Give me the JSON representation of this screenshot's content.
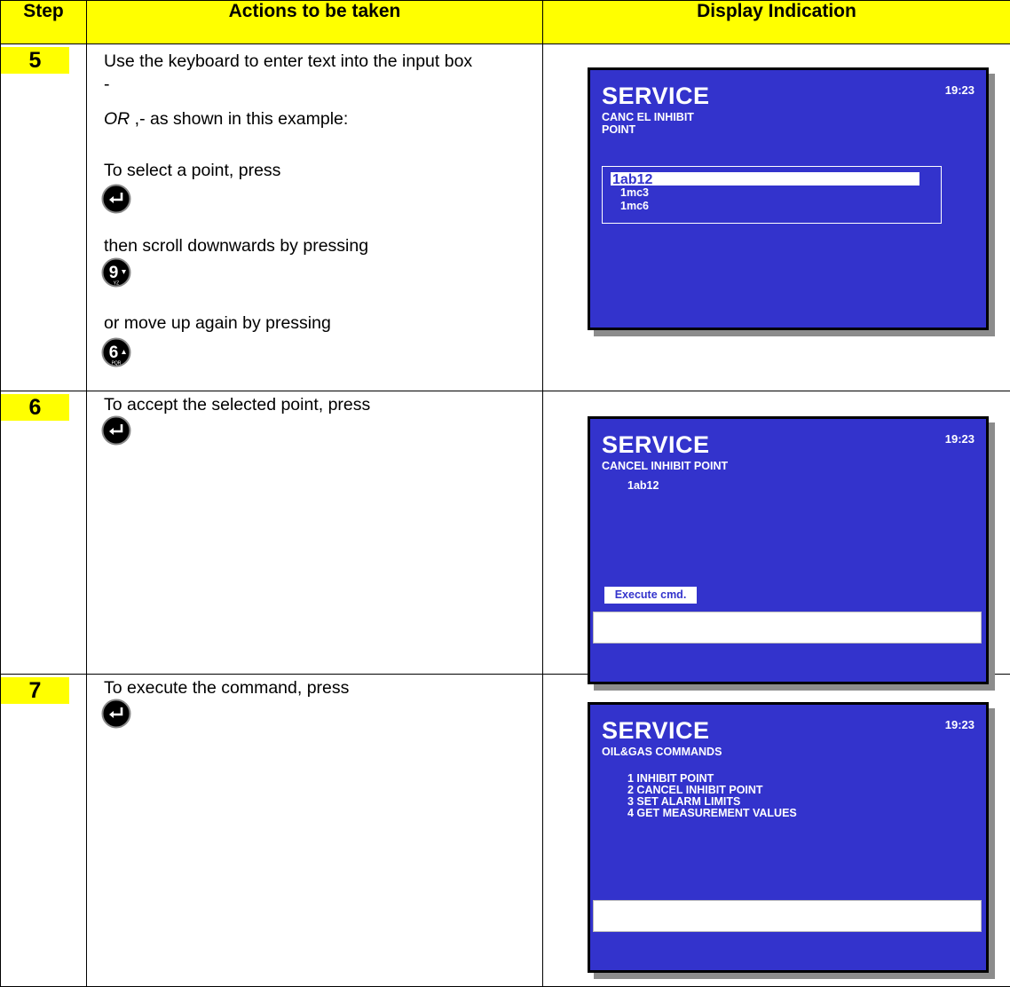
{
  "headers": {
    "step": "Step",
    "actions": "Actions to be taken",
    "display": "Display Indication"
  },
  "rows": [
    {
      "step": "5",
      "lines": [
        "Use the keyboard to enter text into the input box",
        "-",
        "as shown in this example:",
        "To select a point, press",
        "then scroll downwards by pressing",
        "or move up again by pressing"
      ],
      "or_word": "OR",
      "or_sep": ",-",
      "keys": [
        "enter-key",
        "9-key",
        "6-key"
      ],
      "key_labels": {
        "nine": "9",
        "nine_sub": "YZ",
        "six": "6",
        "six_sub": "PQR"
      },
      "screen": {
        "title": "SERVICE",
        "time": "19:23",
        "sub1": "CANC EL INHIBIT",
        "sub2": "POINT",
        "items": [
          "1ab12",
          "1mc3",
          "1mc6"
        ]
      }
    },
    {
      "step": "6",
      "lines": [
        "To accept the selected point, press"
      ],
      "keys": [
        "enter-key"
      ],
      "screen": {
        "title": "SERVICE",
        "time": "19:23",
        "sub1": "CANCEL INHIBIT POINT",
        "value": "1ab12",
        "button": "Execute cmd."
      }
    },
    {
      "step": "7",
      "lines": [
        "To execute the command, press"
      ],
      "keys": [
        "enter-key"
      ],
      "screen": {
        "title": "SERVICE",
        "time": "19:23",
        "sub1": "OIL&GAS COMMANDS",
        "items": [
          "1 INHIBIT POINT",
          "2 CANCEL INHIBIT POINT",
          "3 SET ALARM LIMITS",
          "4 GET MEASUREMENT VALUES"
        ]
      }
    }
  ]
}
